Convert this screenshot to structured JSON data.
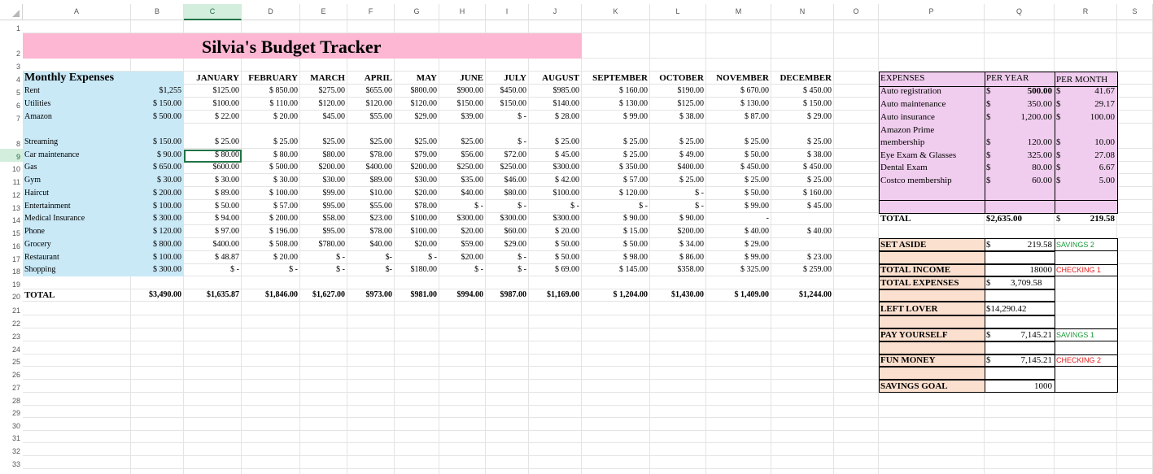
{
  "columns": [
    "A",
    "B",
    "C",
    "D",
    "E",
    "F",
    "G",
    "H",
    "I",
    "J",
    "K",
    "L",
    "M",
    "N",
    "O",
    "P",
    "Q",
    "R",
    "S"
  ],
  "rows": [
    "1",
    "2",
    "3",
    "4",
    "5",
    "6",
    "7",
    "8",
    "9",
    "10",
    "11",
    "12",
    "13",
    "14",
    "15",
    "16",
    "17",
    "18",
    "19",
    "20",
    "21",
    "22",
    "23",
    "24",
    "25",
    "26",
    "27",
    "28",
    "29",
    "30",
    "31",
    "32",
    "33"
  ],
  "selected_column": "C",
  "selected_row": "9",
  "title": "Silvia's Budget Tracker",
  "monthly_heading": "Monthly Expenses",
  "months": [
    "JANUARY",
    "FEBRUARY",
    "MARCH",
    "APRIL",
    "MAY",
    "JUNE",
    "JULY",
    "AUGUST",
    "SEPTEMBER",
    "OCTOBER",
    "NOVEMBER",
    "DECEMBER"
  ],
  "expense_rows": [
    {
      "label": "Rent",
      "amount": "$1,255",
      "cells": [
        "$125.00",
        "$ 850.00",
        "$275.00",
        "$655.00",
        "$800.00",
        "$900.00",
        "$450.00",
        "$985.00",
        "$ 160.00",
        "$190.00",
        "$ 670.00",
        "$ 450.00"
      ]
    },
    {
      "label": "Utilities",
      "amount": "$ 150.00",
      "cells": [
        "$100.00",
        "$ 110.00",
        "$120.00",
        "$120.00",
        "$120.00",
        "$150.00",
        "$150.00",
        "$140.00",
        "$ 130.00",
        "$125.00",
        "$ 130.00",
        "$ 150.00"
      ]
    },
    {
      "label": "Amazon",
      "amount": "$ 500.00",
      "cells": [
        "$ 22.00",
        "$ 20.00",
        "$45.00",
        "$55.00",
        "$29.00",
        "$39.00",
        "$ -",
        "$ 28.00",
        "$ 99.00",
        "$ 38.00",
        "$ 87.00",
        "$ 29.00"
      ]
    },
    {
      "label": "Streaming",
      "amount": "$ 150.00",
      "cells": [
        "$ 25.00",
        "$ 25.00",
        "$25.00",
        "$25.00",
        "$25.00",
        "$25.00",
        "$ -",
        "$ 25.00",
        "$ 25.00",
        "$ 25.00",
        "$ 25.00",
        "$ 25.00"
      ]
    },
    {
      "label": "Car maintenance",
      "amount": "$ 90.00",
      "cells": [
        "$ 80.00",
        "$ 80.00",
        "$80.00",
        "$78.00",
        "$79.00",
        "$56.00",
        "$72.00",
        "$ 45.00",
        "$ 25.00",
        "$ 49.00",
        "$ 50.00",
        "$ 38.00"
      ]
    },
    {
      "label": "Gas",
      "amount": "$ 650.00",
      "cells": [
        "$600.00",
        "$ 500.00",
        "$200.00",
        "$400.00",
        "$200.00",
        "$250.00",
        "$250.00",
        "$300.00",
        "$ 350.00",
        "$400.00",
        "$ 450.00",
        "$ 450.00"
      ]
    },
    {
      "label": "Gym",
      "amount": "$ 30.00",
      "cells": [
        "$ 30.00",
        "$ 30.00",
        "$30.00",
        "$89.00",
        "$30.00",
        "$35.00",
        "$46.00",
        "$ 42.00",
        "$ 57.00",
        "$ 25.00",
        "$ 25.00",
        "$ 25.00"
      ]
    },
    {
      "label": "Haircut",
      "amount": "$ 200.00",
      "cells": [
        "$ 89.00",
        "$ 100.00",
        "$99.00",
        "$10.00",
        "$20.00",
        "$40.00",
        "$80.00",
        "$100.00",
        "$ 120.00",
        "$ -",
        "$ 50.00",
        "$ 160.00"
      ]
    },
    {
      "label": "Entertainment",
      "amount": "$ 100.00",
      "cells": [
        "$ 50.00",
        "$ 57.00",
        "$95.00",
        "$55.00",
        "$78.00",
        "$ -",
        "$ -",
        "$ -",
        "$ -",
        "$ -",
        "$ 99.00",
        "$ 45.00"
      ]
    },
    {
      "label": "Medical Insurance",
      "amount": "$ 300.00",
      "cells": [
        "$ 94.00",
        "$ 200.00",
        "$58.00",
        "$23.00",
        "$100.00",
        "$300.00",
        "$300.00",
        "$300.00",
        "$ 90.00",
        "$ 90.00",
        "-",
        ""
      ]
    },
    {
      "label": "Phone",
      "amount": "$ 120.00",
      "cells": [
        "$ 97.00",
        "$ 196.00",
        "$95.00",
        "$78.00",
        "$100.00",
        "$20.00",
        "$60.00",
        "$ 20.00",
        "$ 15.00",
        "$200.00",
        "$ 40.00",
        "$ 40.00"
      ]
    },
    {
      "label": "Grocery",
      "amount": "$ 800.00",
      "cells": [
        "$400.00",
        "$ 508.00",
        "$780.00",
        "$40.00",
        "$20.00",
        "$59.00",
        "$29.00",
        "$ 50.00",
        "$ 50.00",
        "$ 34.00",
        "$ 29.00",
        ""
      ]
    },
    {
      "label": "Restaurant",
      "amount": "$ 100.00",
      "cells": [
        "$ 48.87",
        "$ 20.00",
        "$ -",
        "$-",
        "$ -",
        "$20.00",
        "$ -",
        "$ 50.00",
        "$ 98.00",
        "$ 86.00",
        "$ 99.00",
        "$ 23.00"
      ]
    },
    {
      "label": "Shopping",
      "amount": "$ 300.00",
      "cells": [
        "$ -",
        "$ -",
        "$ -",
        "$-",
        "$180.00",
        "$ -",
        "$ -",
        "$ 69.00",
        "$ 145.00",
        "$358.00",
        "$ 325.00",
        "$ 259.00"
      ]
    }
  ],
  "total_label": "TOTAL",
  "total_amount": "$3,490.00",
  "total_cells": [
    "$1,635.87",
    "$1,846.00",
    "$1,627.00",
    "$973.00",
    "$981.00",
    "$994.00",
    "$987.00",
    "$1,169.00",
    "$ 1,204.00",
    "$1,430.00",
    "$ 1,409.00",
    "$1,244.00"
  ],
  "expenses_table": {
    "headers": [
      "EXPENSES",
      "PER YEAR",
      "PER MONTH"
    ],
    "items": [
      {
        "name": "Auto registration",
        "year": "500.00",
        "month": "41.67"
      },
      {
        "name": "Auto maintenance",
        "year": "350.00",
        "month": "29.17"
      },
      {
        "name": "Auto insurance",
        "year": "1,200.00",
        "month": "100.00"
      },
      {
        "name": "Amazon Prime membership",
        "year": "120.00",
        "month": "10.00"
      },
      {
        "name": "Eye Exam & Glasses",
        "year": "325.00",
        "month": "27.08"
      },
      {
        "name": "Dental Exam",
        "year": "80.00",
        "month": "6.67"
      },
      {
        "name": "Costco membership",
        "year": "60.00",
        "month": "5.00"
      }
    ],
    "total_label": "TOTAL",
    "total_year": "$2,635.00",
    "total_month": "219.58",
    "currency": "$"
  },
  "summary": {
    "set_aside_label": "SET ASIDE",
    "set_aside_value": "219.58",
    "set_aside_note": "SAVINGS 2",
    "total_income_label": "TOTAL INCOME",
    "total_income_value": "18000",
    "total_income_note": "CHECKING 1",
    "total_expenses_label": "TOTAL EXPENSES",
    "total_expenses_value": "3,709.58",
    "left_over_label": "LEFT LOVER",
    "left_over_value": "$14,290.42",
    "pay_yourself_label": "PAY YOURSELF",
    "pay_yourself_value": "7,145.21",
    "pay_yourself_note": "SAVINGS 1",
    "fun_money_label": "FUN MONEY",
    "fun_money_value": "7,145.21",
    "fun_money_note": "CHECKING 2",
    "savings_goal_label": "SAVINGS GOAL",
    "savings_goal_value": "1000",
    "currency": "$"
  },
  "colors": {
    "title_fill": "#fdb7d2",
    "monthly_fill": "#c9e9f7",
    "expenses_fill": "#f0cdee",
    "summary_fill": "#fbe0cf",
    "green_note": "#1c9b3a",
    "red_note": "#e31c1c",
    "selection": "#217346"
  }
}
